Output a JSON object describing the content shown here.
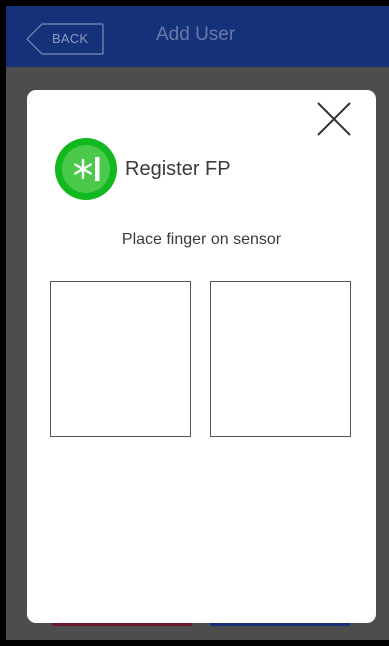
{
  "header": {
    "back_label": "BACK",
    "title": "Add User"
  },
  "dialog": {
    "title": "Register FP",
    "instruction": "Place finger on sensor",
    "badge_icon": "fingerprint-register-icon",
    "close_icon": "close-icon"
  },
  "colors": {
    "header_bg": "#14317a",
    "overlay": "#4d4d4d",
    "badge_green": "#12b81f",
    "cancel_button": "#6b1a2e",
    "confirm_button": "#14317a"
  }
}
